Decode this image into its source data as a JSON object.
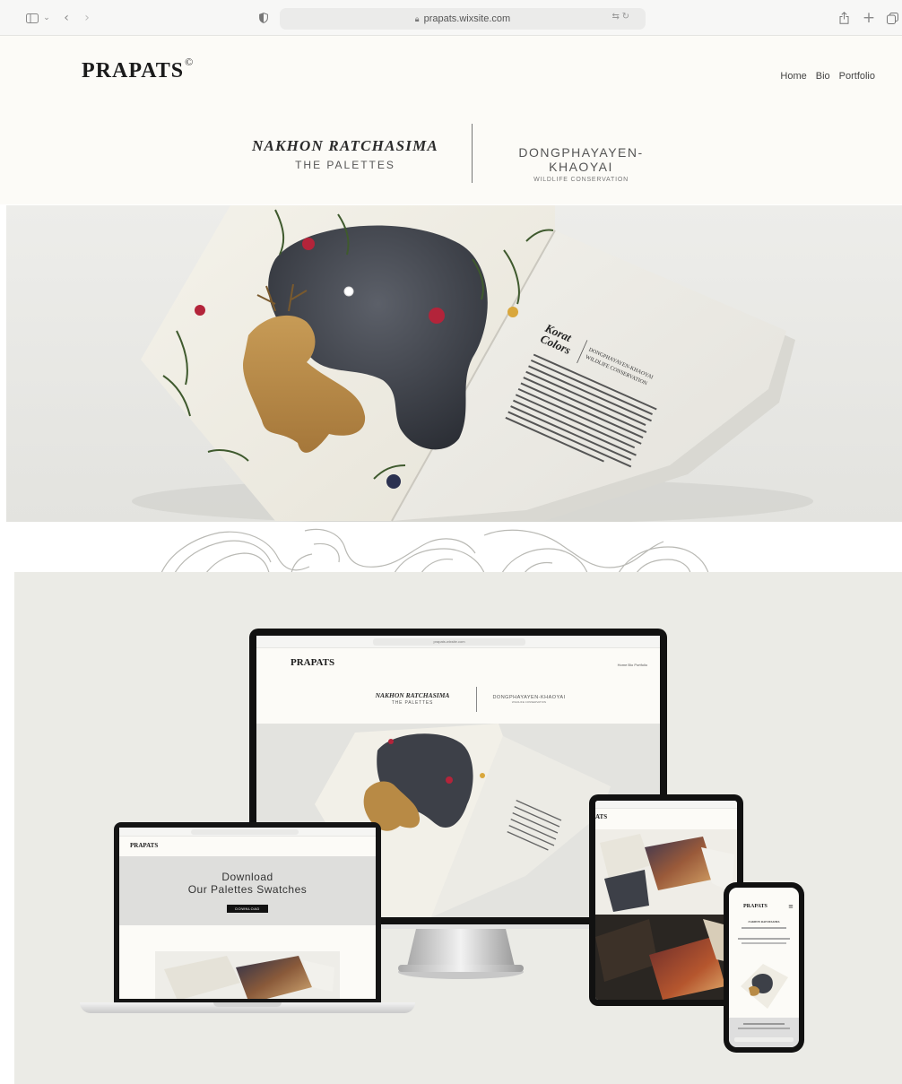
{
  "browser": {
    "url": "prapats.wixsite.com",
    "icons": [
      "sidebar-icon",
      "chevron-down-icon",
      "back-icon",
      "forward-icon",
      "shield-icon",
      "lock-icon",
      "translate-icon",
      "reload-icon",
      "share-icon",
      "new-tab-icon",
      "tabs-icon"
    ]
  },
  "site": {
    "logo": "PRAPATS",
    "logo_mark": "©",
    "nav": [
      "Home",
      "Bio",
      "Portfolio"
    ],
    "left_title": "NAKHON RATCHASIMA",
    "left_subtitle": "THE PALETTES",
    "right_title": "DONGPHAYAYEN-KHAOYAI",
    "right_subtitle": "WILDLIFE CONSERVATION"
  },
  "book": {
    "heading_line1": "Korat",
    "heading_line2": "Colors",
    "side_label_1": "DONGPHAYAYEN-KHAOYAI",
    "side_label_2": "WILDLIFE CONSERVATION"
  },
  "mockup": {
    "desktop": {
      "url": "prapats.wixsite.com",
      "logo": "PRAPATS",
      "nav": "Home  Bio  Portfolio",
      "left_title": "NAKHON RATCHASIMA",
      "left_subtitle": "THE PALETTES",
      "right_title": "DONGPHAYAYEN-KHAOYAI",
      "right_subtitle": "WILDLIFE CONSERVATION"
    },
    "laptop": {
      "logo": "PRAPATS",
      "download_line1": "Download",
      "download_line2": "Our Palettes Swatches",
      "button": "DOWNLOAD"
    },
    "tablet": {
      "logo_fragment": "ATS"
    },
    "phone": {
      "logo": "PRAPATS",
      "title": "NAKHON RATCHASIMA"
    }
  },
  "colors": {
    "page_bg": "#fcfbf7",
    "hero_bg": "#e6e6e2",
    "mock_bg": "#ebebe6",
    "accent_dark": "#1b1b1b"
  }
}
